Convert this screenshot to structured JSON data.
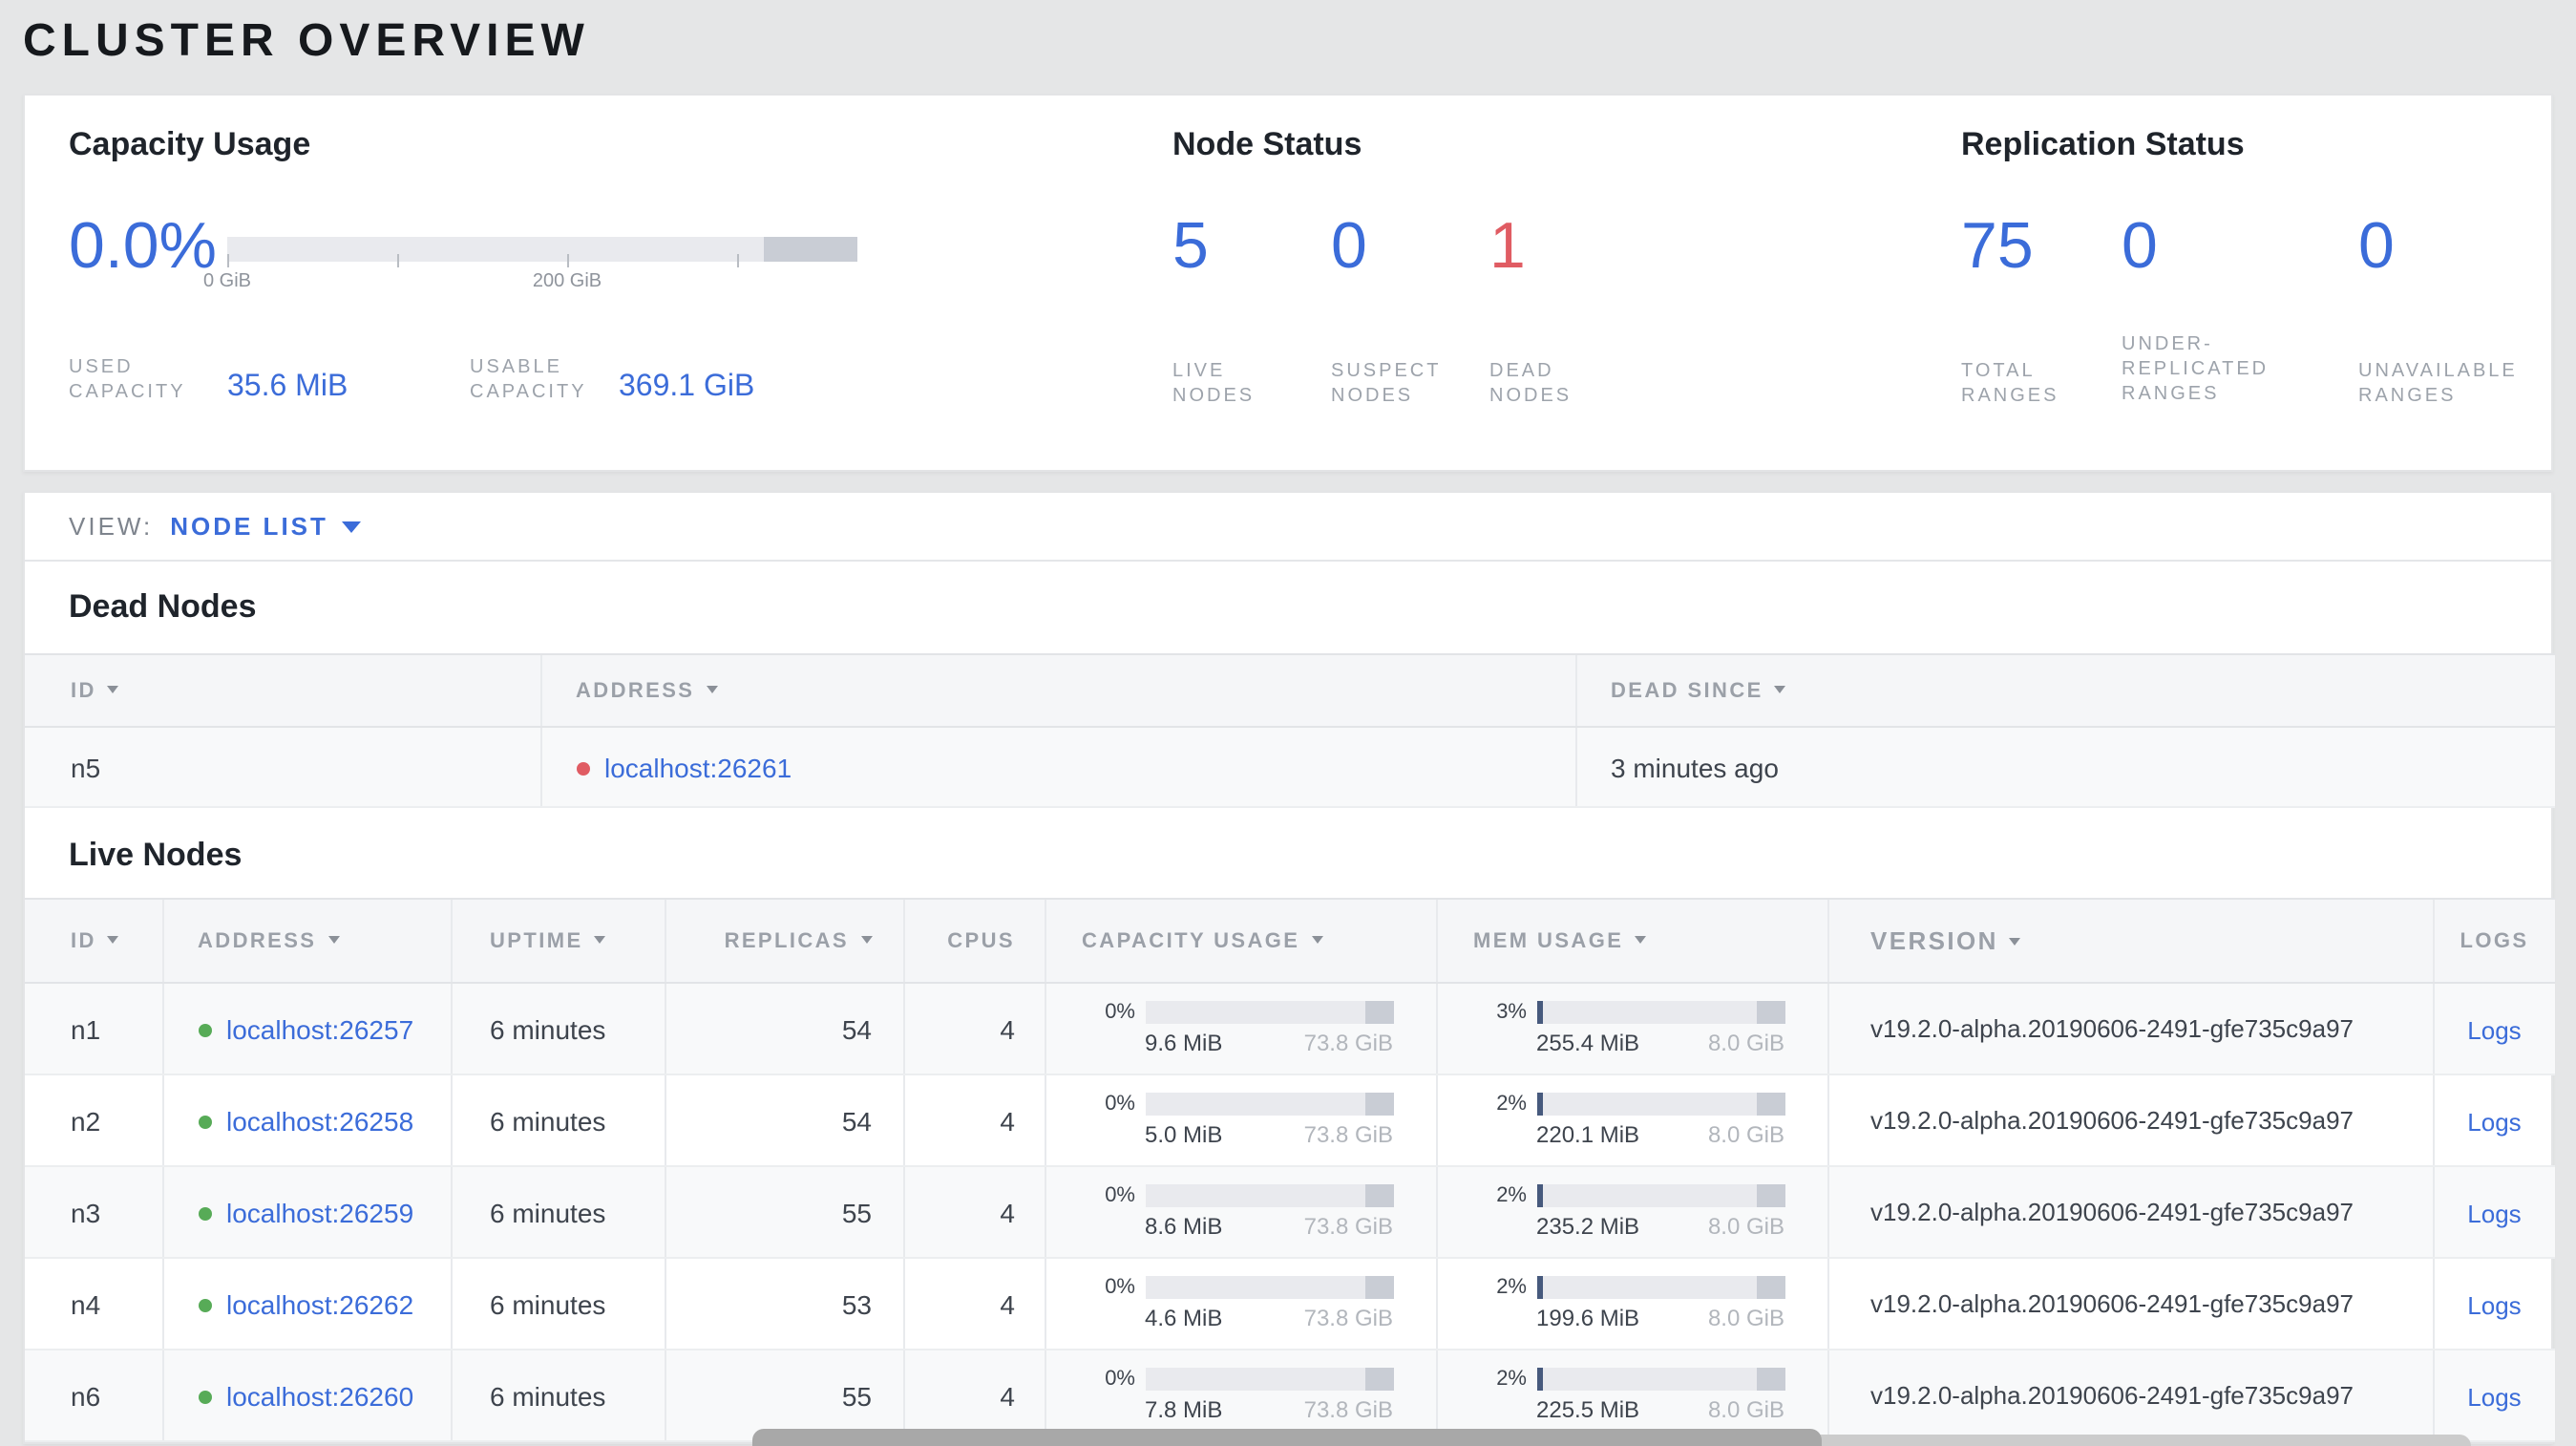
{
  "colors": {
    "blue": "#3b6cd9",
    "red": "#e05c63",
    "green": "#57ab57",
    "page_bg": "#e5e6e7"
  },
  "page": {
    "title": "CLUSTER OVERVIEW"
  },
  "summary": {
    "capacity": {
      "heading": "Capacity Usage",
      "percent": "0.0%",
      "tick_zero": "0 GiB",
      "tick_two_hundred": "200 GiB",
      "used": {
        "label": "USED\nCAPACITY",
        "value": "35.6 MiB"
      },
      "usable": {
        "label": "USABLE\nCAPACITY",
        "value": "369.1 GiB"
      }
    },
    "node_status": {
      "heading": "Node Status",
      "stats": {
        "live": {
          "value": "5",
          "label": "LIVE\nNODES"
        },
        "suspect": {
          "value": "0",
          "label": "SUSPECT\nNODES"
        },
        "dead": {
          "value": "1",
          "label": "DEAD\nNODES"
        }
      }
    },
    "replication": {
      "heading": "Replication Status",
      "stats": {
        "total": {
          "value": "75",
          "label": "TOTAL\nRANGES"
        },
        "under_replicated": {
          "value": "0",
          "label": "UNDER-\nREPLICATED\nRANGES"
        },
        "unavailable": {
          "value": "0",
          "label": "UNAVAILABLE\nRANGES"
        }
      }
    }
  },
  "view_bar": {
    "label": "VIEW:",
    "selected": "NODE LIST"
  },
  "dead_nodes": {
    "heading": "Dead Nodes",
    "columns": {
      "id": "ID",
      "address": "ADDRESS",
      "dead_since": "DEAD SINCE"
    },
    "rows": [
      {
        "id": "n5",
        "address": "localhost:26261",
        "dead_since": "3 minutes ago"
      }
    ]
  },
  "live_nodes": {
    "heading": "Live Nodes",
    "columns": {
      "id": "ID",
      "address": "ADDRESS",
      "uptime": "UPTIME",
      "replicas": "REPLICAS",
      "cpus": "CPUS",
      "capacity": "CAPACITY USAGE",
      "mem": "MEM USAGE",
      "version": "VERSION",
      "logs": "LOGS"
    },
    "rows": [
      {
        "id": "n1",
        "address": "localhost:26257",
        "uptime": "6 minutes",
        "replicas": "54",
        "cpus": "4",
        "capacity": {
          "pct": "0%",
          "fill": 0,
          "used": "9.6 MiB",
          "total": "73.8 GiB"
        },
        "mem": {
          "pct": "3%",
          "fill": 3,
          "used": "255.4 MiB",
          "total": "8.0 GiB"
        },
        "version": "v19.2.0-alpha.20190606-2491-gfe735c9a97",
        "logs": "Logs"
      },
      {
        "id": "n2",
        "address": "localhost:26258",
        "uptime": "6 minutes",
        "replicas": "54",
        "cpus": "4",
        "capacity": {
          "pct": "0%",
          "fill": 0,
          "used": "5.0 MiB",
          "total": "73.8 GiB"
        },
        "mem": {
          "pct": "2%",
          "fill": 2.5,
          "used": "220.1 MiB",
          "total": "8.0 GiB"
        },
        "version": "v19.2.0-alpha.20190606-2491-gfe735c9a97",
        "logs": "Logs"
      },
      {
        "id": "n3",
        "address": "localhost:26259",
        "uptime": "6 minutes",
        "replicas": "55",
        "cpus": "4",
        "capacity": {
          "pct": "0%",
          "fill": 0,
          "used": "8.6 MiB",
          "total": "73.8 GiB"
        },
        "mem": {
          "pct": "2%",
          "fill": 2.5,
          "used": "235.2 MiB",
          "total": "8.0 GiB"
        },
        "version": "v19.2.0-alpha.20190606-2491-gfe735c9a97",
        "logs": "Logs"
      },
      {
        "id": "n4",
        "address": "localhost:26262",
        "uptime": "6 minutes",
        "replicas": "53",
        "cpus": "4",
        "capacity": {
          "pct": "0%",
          "fill": 0,
          "used": "4.6 MiB",
          "total": "73.8 GiB"
        },
        "mem": {
          "pct": "2%",
          "fill": 2.5,
          "used": "199.6 MiB",
          "total": "8.0 GiB"
        },
        "version": "v19.2.0-alpha.20190606-2491-gfe735c9a97",
        "logs": "Logs"
      },
      {
        "id": "n6",
        "address": "localhost:26260",
        "uptime": "6 minutes",
        "replicas": "55",
        "cpus": "4",
        "capacity": {
          "pct": "0%",
          "fill": 0,
          "used": "7.8 MiB",
          "total": "73.8 GiB"
        },
        "mem": {
          "pct": "2%",
          "fill": 2.5,
          "used": "225.5 MiB",
          "total": "8.0 GiB"
        },
        "version": "v19.2.0-alpha.20190606-2491-gfe735c9a97",
        "logs": "Logs"
      }
    ]
  }
}
